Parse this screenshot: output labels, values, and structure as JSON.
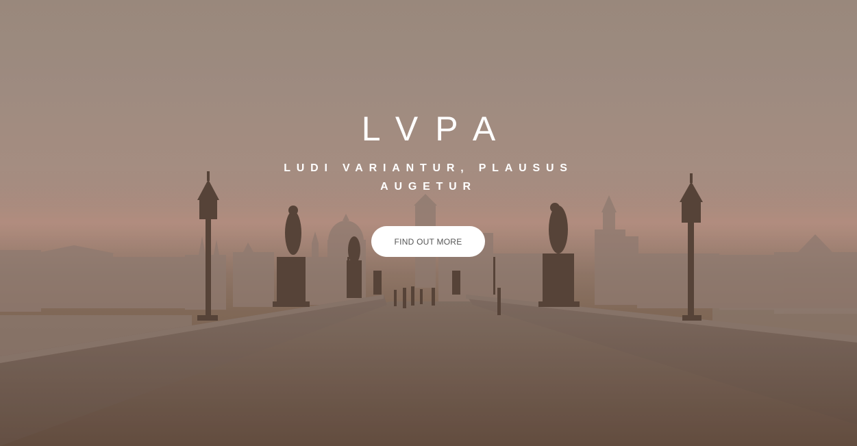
{
  "hero": {
    "title": "LVPA",
    "subtitle": "LUDI VARIANTUR, PLAUSUS AUGETUR",
    "cta_label": "FIND OUT MORE"
  },
  "colors": {
    "sky": "#a08e84",
    "haze": "#c29a88",
    "ground": "#6a5243",
    "silhouette": "#4a3a32",
    "text": "#ffffff",
    "button_bg": "#ffffff",
    "button_text": "#555555"
  },
  "background": {
    "icon": "bridge-scene-illustration"
  }
}
